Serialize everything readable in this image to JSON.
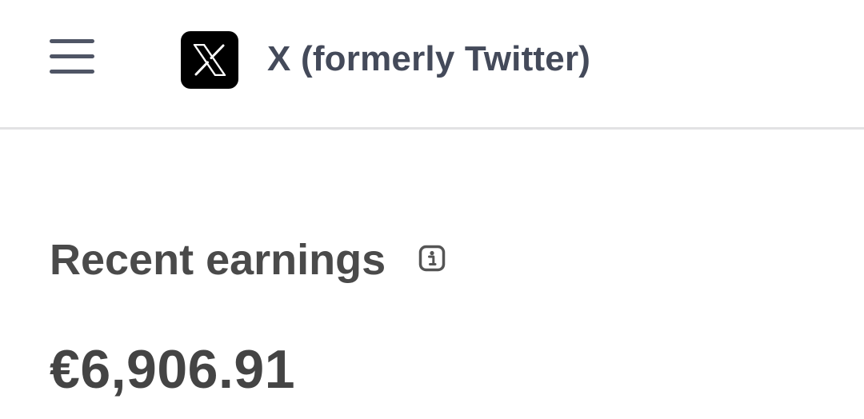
{
  "header": {
    "menu_icon": "hamburger-menu-icon",
    "logo_icon": "x-logo-icon",
    "app_title": "X (formerly Twitter)"
  },
  "earnings": {
    "title": "Recent earnings",
    "info_icon": "info-icon",
    "amount": "€6,906.91"
  },
  "colors": {
    "header_text": "#444a5a",
    "body_text": "#4a4a4a",
    "divider": "#e2e2e4",
    "logo_bg": "#000000"
  }
}
